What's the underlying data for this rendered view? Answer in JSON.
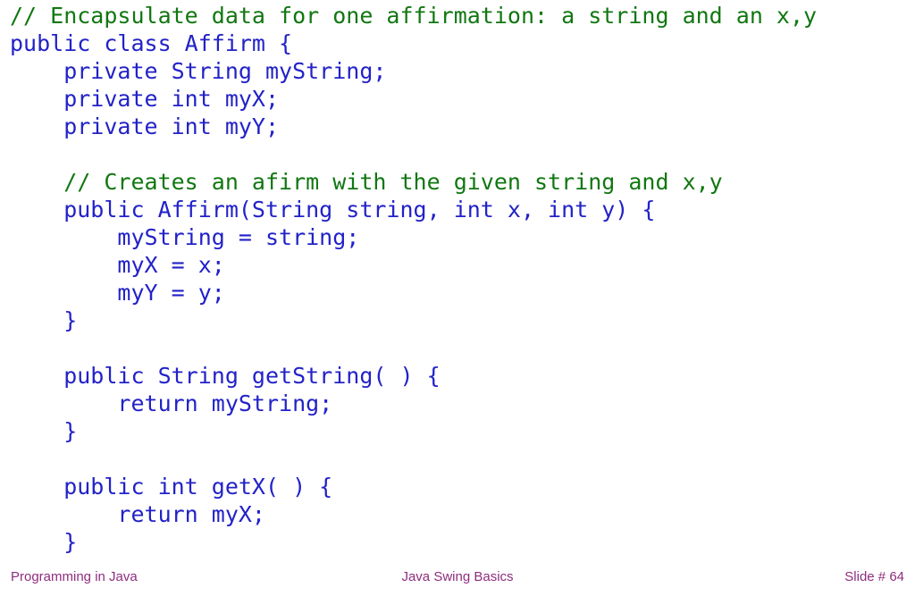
{
  "slide": {
    "colors": {
      "background": "#ffffff",
      "comment": "#117711",
      "code": "#2222c8",
      "footer": "#8f2d7e"
    },
    "code_lines": [
      {
        "kind": "comment",
        "text": "// Encapsulate data for one affirmation: a string and an x,y"
      },
      {
        "kind": "code",
        "text": "public class Affirm {"
      },
      {
        "kind": "code",
        "text": "    private String myString;"
      },
      {
        "kind": "code",
        "text": "    private int myX;"
      },
      {
        "kind": "code",
        "text": "    private int myY;"
      },
      {
        "kind": "blank",
        "text": " "
      },
      {
        "kind": "comment",
        "text": "    // Creates an afirm with the given string and x,y"
      },
      {
        "kind": "code",
        "text": "    public Affirm(String string, int x, int y) {"
      },
      {
        "kind": "code",
        "text": "        myString = string;"
      },
      {
        "kind": "code",
        "text": "        myX = x;"
      },
      {
        "kind": "code",
        "text": "        myY = y;"
      },
      {
        "kind": "code",
        "text": "    }"
      },
      {
        "kind": "blank",
        "text": " "
      },
      {
        "kind": "code",
        "text": "    public String getString( ) {"
      },
      {
        "kind": "code",
        "text": "        return myString;"
      },
      {
        "kind": "code",
        "text": "    }"
      },
      {
        "kind": "blank",
        "text": " "
      },
      {
        "kind": "code",
        "text": "    public int getX( ) {"
      },
      {
        "kind": "code",
        "text": "        return myX;"
      },
      {
        "kind": "code",
        "text": "    }"
      }
    ],
    "footer": {
      "left": "Programming in Java",
      "center": "Java Swing Basics",
      "right": "Slide # 64"
    }
  }
}
